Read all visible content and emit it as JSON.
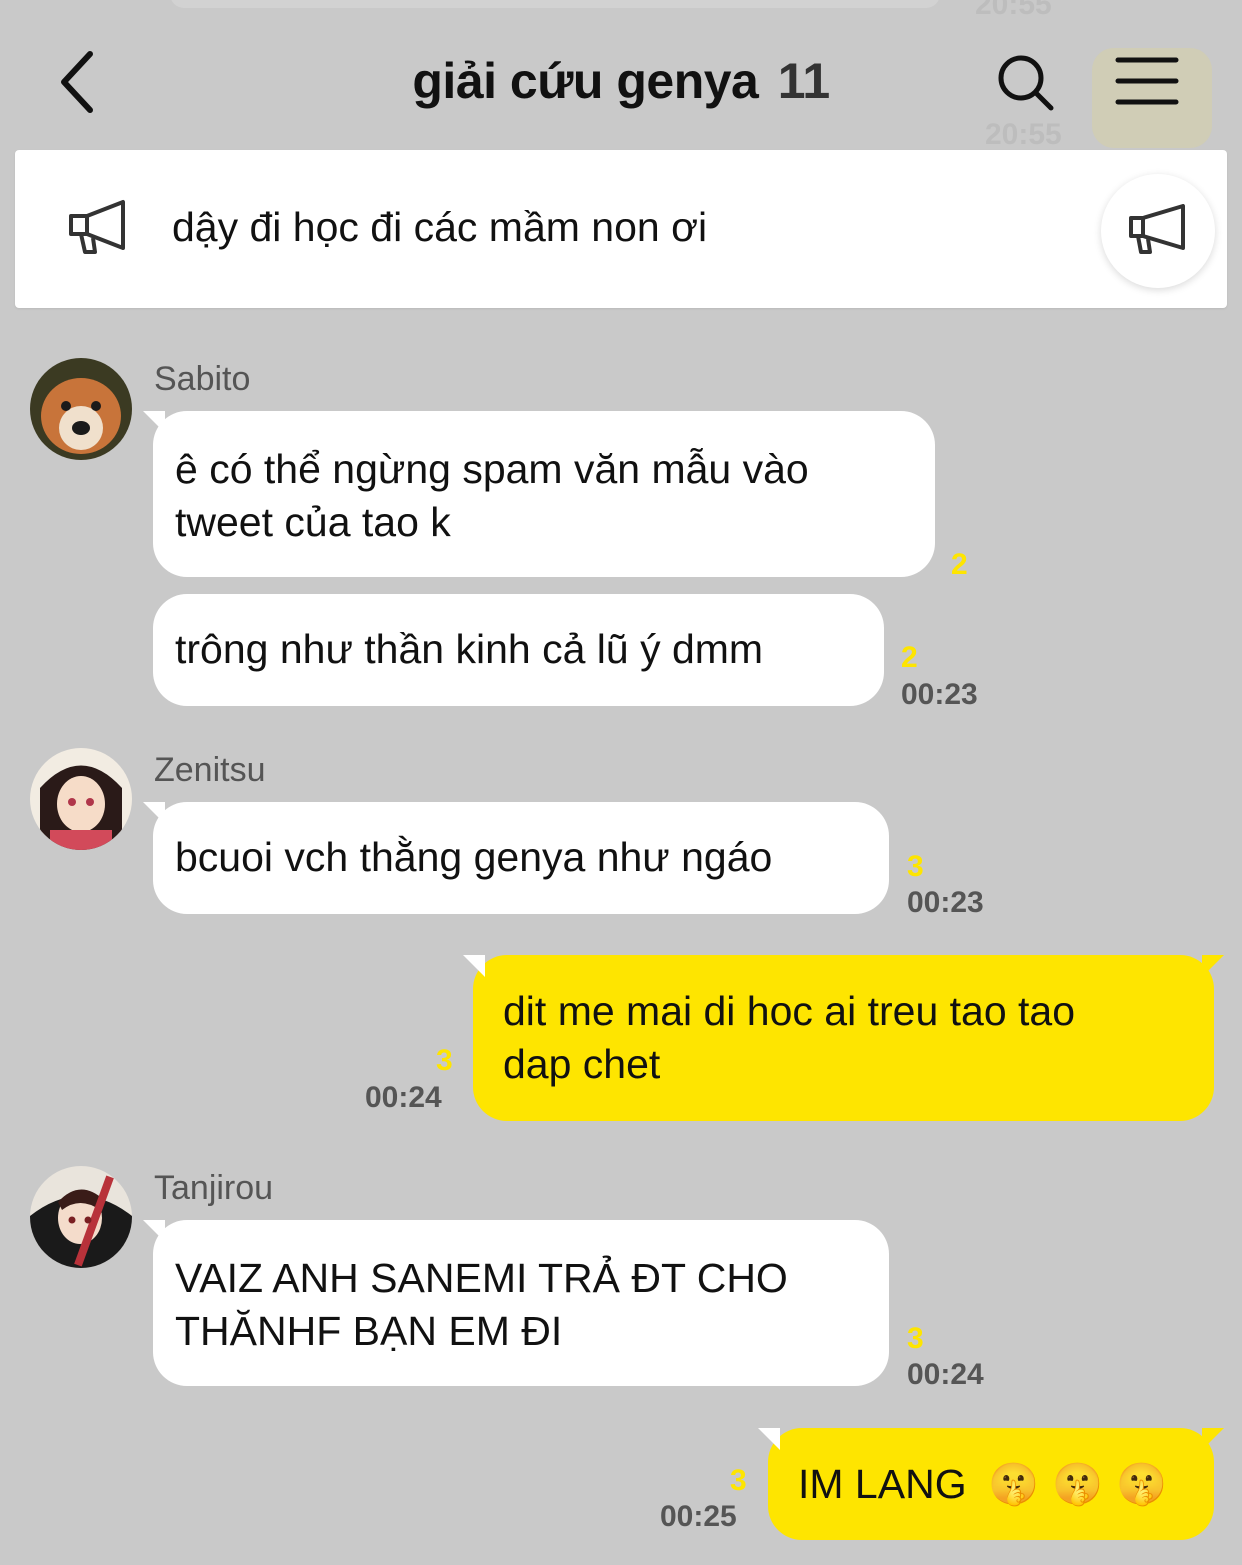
{
  "header": {
    "title": "giải cứu genya",
    "member_count": "11"
  },
  "ghost": {
    "top_time": "20:55",
    "right_time": "20:55"
  },
  "notice": {
    "text": "dậy đi học đi các mầm non ơi"
  },
  "messages": [
    {
      "sender": "Sabito",
      "line1": "ê có thể ngừng spam văn mẫu vào",
      "line2": "tweet của tao k",
      "read": "2",
      "time": ""
    },
    {
      "sender": "",
      "line1": "trông như thần kinh cả lũ ý dmm",
      "line2": "",
      "read": "2",
      "time": "00:23"
    },
    {
      "sender": "Zenitsu",
      "line1": "bcuoi vch thằng genya như ngáo",
      "line2": "",
      "read": "3",
      "time": "00:23"
    },
    {
      "sender": "me",
      "line1": "dit me mai di hoc ai treu tao tao",
      "line2": "dap chet",
      "read": "3",
      "time": "00:24"
    },
    {
      "sender": "Tanjirou",
      "line1": "VAIZ ANH SANEMI TRẢ ĐT CHO",
      "line2": "THĂNHF BẠN EM ĐI",
      "read": "3",
      "time": "00:24"
    },
    {
      "sender": "me",
      "line1": "IM LANG",
      "emoji": "🤫 🤫 🤫",
      "read": "3",
      "time": "00:25"
    }
  ],
  "colors": {
    "background": "#c9c9c9",
    "my_bubble": "#fee500",
    "other_bubble": "#ffffff",
    "read_count": "#fee500"
  },
  "icons": [
    "back-icon",
    "search-icon",
    "menu-icon",
    "megaphone-icon",
    "shushing-face-emoji"
  ]
}
